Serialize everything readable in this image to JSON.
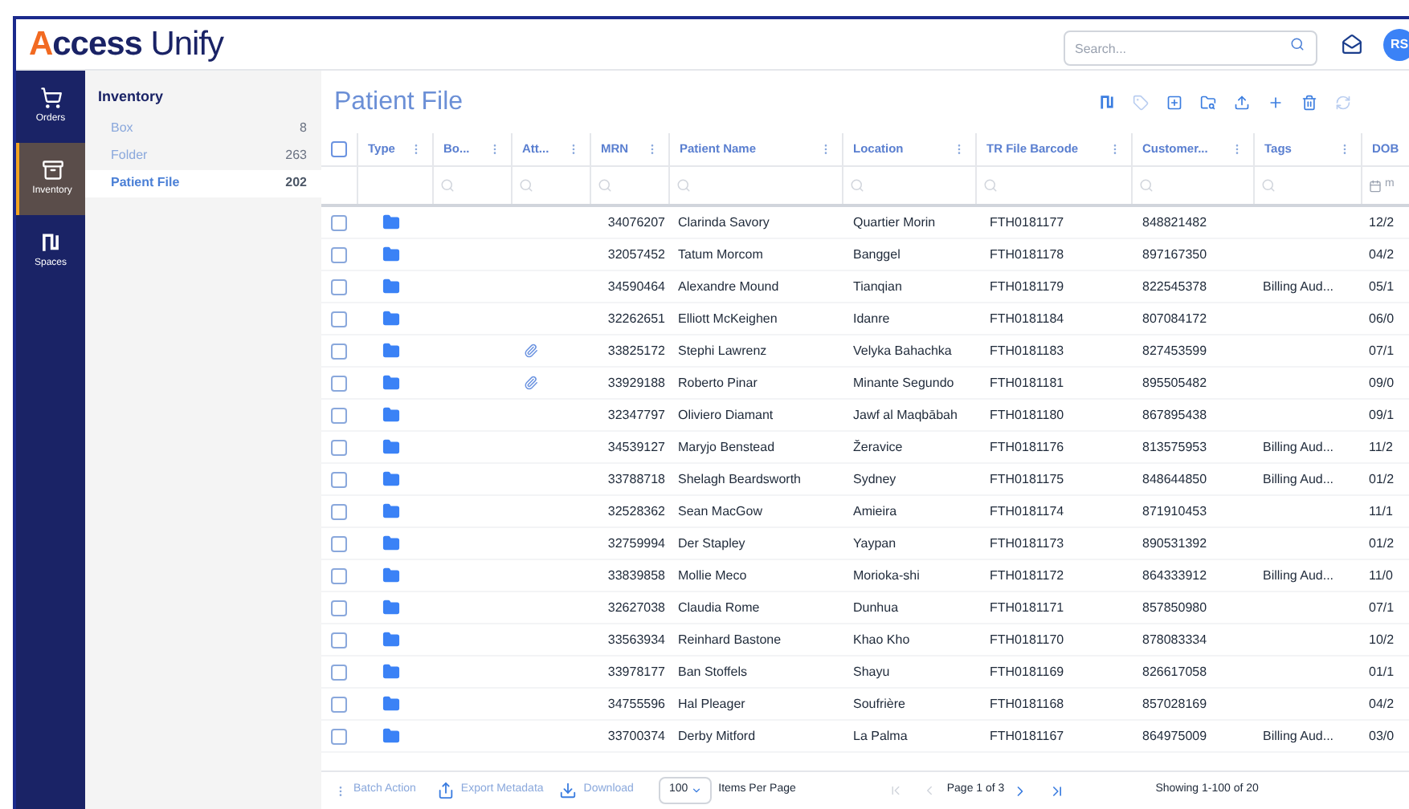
{
  "header": {
    "logo_bold": "Access",
    "logo_light": "Unify",
    "search": {
      "placeholder": "Search..."
    },
    "avatar": "RS"
  },
  "nav": [
    {
      "label": "Orders",
      "selected": false
    },
    {
      "label": "Inventory",
      "selected": true
    },
    {
      "label": "Spaces",
      "selected": false
    }
  ],
  "sidebar": {
    "title": "Inventory",
    "items": [
      {
        "label": "Box",
        "count": "8",
        "selected": false
      },
      {
        "label": "Folder",
        "count": "263",
        "selected": false
      },
      {
        "label": "Patient File",
        "count": "202",
        "selected": true
      }
    ]
  },
  "page_title": "Patient File",
  "toolbar": [
    {
      "disabled": false
    },
    {
      "disabled": true
    },
    {
      "disabled": false
    },
    {
      "disabled": false
    },
    {
      "disabled": false
    },
    {
      "disabled": false
    },
    {
      "disabled": false
    },
    {
      "disabled": true
    }
  ],
  "table": {
    "all_checked": false,
    "columns": [
      {
        "label": "Type"
      },
      {
        "label": "Bo..."
      },
      {
        "label": "Att..."
      },
      {
        "label": "MRN"
      },
      {
        "label": "Patient Name"
      },
      {
        "label": "Location"
      },
      {
        "label": "TR File Barcode"
      },
      {
        "label": "Customer..."
      },
      {
        "label": "Tags"
      },
      {
        "label": "DOB",
        "placeholder": "m"
      }
    ],
    "rows": [
      {
        "checked": false,
        "attachment": false,
        "mrn": "34076207",
        "name": "Clarinda Savory",
        "location": "Quartier Morin",
        "barcode": "FTH0181177",
        "customer": "848821482",
        "tags": "",
        "dob": "12/2"
      },
      {
        "checked": false,
        "attachment": false,
        "mrn": "32057452",
        "name": "Tatum Morcom",
        "location": "Banggel",
        "barcode": "FTH0181178",
        "customer": "897167350",
        "tags": "",
        "dob": "04/2"
      },
      {
        "checked": false,
        "attachment": false,
        "mrn": "34590464",
        "name": "Alexandre Mound",
        "location": "Tianqian",
        "barcode": "FTH0181179",
        "customer": "822545378",
        "tags": "Billing Aud...",
        "dob": "05/1"
      },
      {
        "checked": false,
        "attachment": false,
        "mrn": "32262651",
        "name": "Elliott McKeighen",
        "location": "Idanre",
        "barcode": "FTH0181184",
        "customer": "807084172",
        "tags": "",
        "dob": "06/0"
      },
      {
        "checked": false,
        "attachment": true,
        "mrn": "33825172",
        "name": "Stephi Lawrenz",
        "location": "Velyka Bahachka",
        "barcode": "FTH0181183",
        "customer": "827453599",
        "tags": "",
        "dob": "07/1"
      },
      {
        "checked": false,
        "attachment": true,
        "mrn": "33929188",
        "name": "Roberto Pinar",
        "location": "Minante Segundo",
        "barcode": "FTH0181181",
        "customer": "895505482",
        "tags": "",
        "dob": "09/0"
      },
      {
        "checked": false,
        "attachment": false,
        "mrn": "32347797",
        "name": "Oliviero Diamant",
        "location": "Jawf al Maqbābah",
        "barcode": "FTH0181180",
        "customer": "867895438",
        "tags": "",
        "dob": "09/1"
      },
      {
        "checked": false,
        "attachment": false,
        "mrn": "34539127",
        "name": "Maryjo Benstead",
        "location": "Žeravice",
        "barcode": "FTH0181176",
        "customer": "813575953",
        "tags": "Billing Aud...",
        "dob": "11/2"
      },
      {
        "checked": false,
        "attachment": false,
        "mrn": "33788718",
        "name": "Shelagh Beardsworth",
        "location": "Sydney",
        "barcode": "FTH0181175",
        "customer": "848644850",
        "tags": "Billing Aud...",
        "dob": "01/2"
      },
      {
        "checked": false,
        "attachment": false,
        "mrn": "32528362",
        "name": "Sean MacGow",
        "location": "Amieira",
        "barcode": "FTH0181174",
        "customer": "871910453",
        "tags": "",
        "dob": "11/1"
      },
      {
        "checked": false,
        "attachment": false,
        "mrn": "32759994",
        "name": "Der Stapley",
        "location": "Yaypan",
        "barcode": "FTH0181173",
        "customer": "890531392",
        "tags": "",
        "dob": "01/2"
      },
      {
        "checked": false,
        "attachment": false,
        "mrn": "33839858",
        "name": "Mollie Meco",
        "location": "Morioka-shi",
        "barcode": "FTH0181172",
        "customer": "864333912",
        "tags": "Billing Aud...",
        "dob": "11/0"
      },
      {
        "checked": false,
        "attachment": false,
        "mrn": "32627038",
        "name": "Claudia Rome",
        "location": "Dunhua",
        "barcode": "FTH0181171",
        "customer": "857850980",
        "tags": "",
        "dob": "07/1"
      },
      {
        "checked": false,
        "attachment": false,
        "mrn": "33563934",
        "name": "Reinhard Bastone",
        "location": "Khao Kho",
        "barcode": "FTH0181170",
        "customer": "878083334",
        "tags": "",
        "dob": "10/2"
      },
      {
        "checked": false,
        "attachment": false,
        "mrn": "33978177",
        "name": "Ban Stoffels",
        "location": "Shayu",
        "barcode": "FTH0181169",
        "customer": "826617058",
        "tags": "",
        "dob": "01/1"
      },
      {
        "checked": false,
        "attachment": false,
        "mrn": "34755596",
        "name": "Hal Pleager",
        "location": "Soufrière",
        "barcode": "FTH0181168",
        "customer": "857028169",
        "tags": "",
        "dob": "04/2"
      },
      {
        "checked": false,
        "attachment": false,
        "mrn": "33700374",
        "name": "Derby Mitford",
        "location": "La Palma",
        "barcode": "FTH0181167",
        "customer": "864975009",
        "tags": "Billing Aud...",
        "dob": "03/0"
      }
    ]
  },
  "footer": {
    "batch_action": "Batch Action",
    "export": "Export Metadata",
    "download": "Download",
    "page_size": "100",
    "page_size_label": "Items Per Page",
    "page": "Page 1 of 3",
    "showing": "Showing 1-100 of 20"
  }
}
